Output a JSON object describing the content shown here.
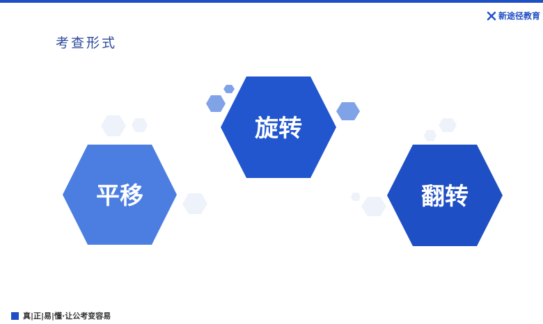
{
  "brand": {
    "name": "新途径教育",
    "icon": "x-logo-icon",
    "color": "#1f4fc4"
  },
  "title": "考查形式",
  "hexagons": [
    {
      "id": "translate",
      "label": "平移",
      "color": "#4b7ee0"
    },
    {
      "id": "rotate",
      "label": "旋转",
      "color": "#2256cf"
    },
    {
      "id": "flip",
      "label": "翻转",
      "color": "#1f4fc4"
    }
  ],
  "footer": {
    "slogan": "真|正|易|懂·让公考变容易"
  }
}
